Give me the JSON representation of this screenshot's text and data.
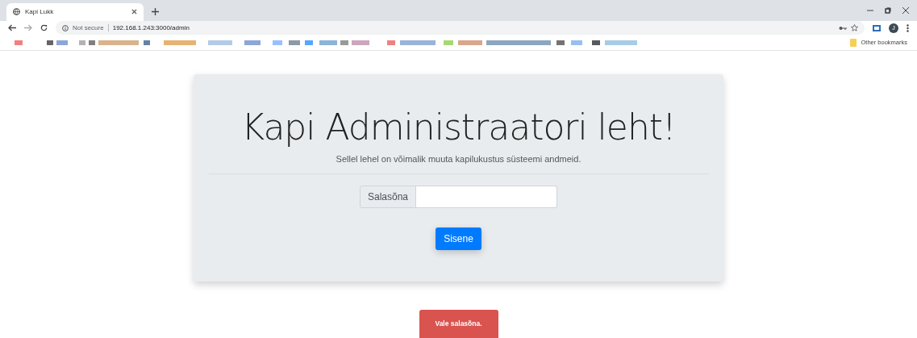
{
  "browser": {
    "tab": {
      "title": "Kapi Lukk",
      "selected": true
    },
    "security": "Not secure",
    "url": "192.168.1.243:3000/admin",
    "avatar": "J",
    "other_bookmarks": "Other bookmarks"
  },
  "card": {
    "title": "Kapi Administraatori leht!",
    "subtitle": "Sellel lehel on võimalik muuta kapilukustus süsteemi andmeid.",
    "field_label": "Salasõna",
    "button": "Sisene"
  },
  "alert": {
    "text": "Vale salasõna."
  }
}
